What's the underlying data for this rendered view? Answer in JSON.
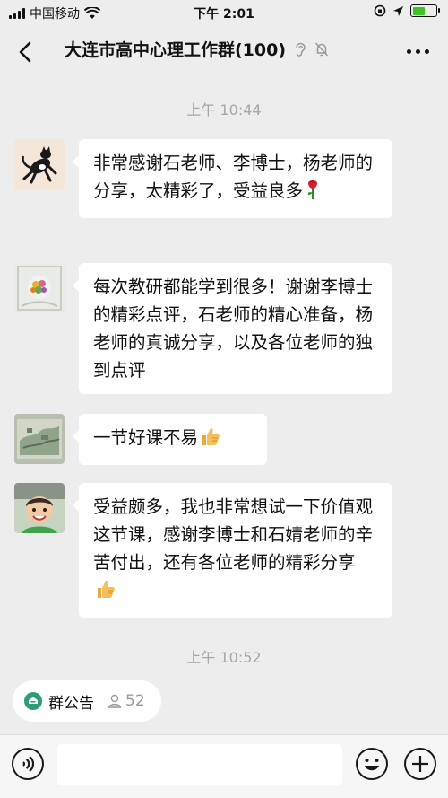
{
  "status_bar": {
    "carrier": "中国移动",
    "time": "下午 2:01"
  },
  "nav": {
    "title": "大连市高中心理工作群(100)",
    "icons": [
      "back-chevron-icon",
      "ear-icon",
      "mute-bell-icon",
      "more-dots-icon"
    ]
  },
  "chat": {
    "timestamps": [
      "上午 10:44",
      "上午 10:52"
    ],
    "messages": [
      {
        "avatar": "cat-avatar",
        "text": "非常感谢石老师、李博士，杨老师的分享，太精彩了，受益良多",
        "emoji": "rose-icon"
      },
      {
        "avatar": "flower-avatar",
        "text": "每次教研都能学到很多！谢谢李博士的精彩点评，石老师的精心准备，杨老师的真诚分享，以及各位老师的独到点评",
        "emoji": ""
      },
      {
        "avatar": "painting-avatar",
        "text": "一节好课不易",
        "emoji": "thumbs-up-icon"
      },
      {
        "avatar": "child-avatar",
        "text": "受益颇多，我也非常想试一下价值观这节课，感谢李博士和石婧老师的辛苦付出，还有各位老师的精彩分享",
        "emoji": "thumbs-up-icon"
      }
    ]
  },
  "announcement": {
    "label": "群公告",
    "count": "52"
  },
  "input_bar": {
    "placeholder": "",
    "icons": [
      "voice-icon",
      "emoji-icon",
      "plus-icon"
    ]
  },
  "colors": {
    "background": "#ededed",
    "bubble": "#ffffff",
    "timestamp": "#a6a6a6",
    "accent_green": "#3cc51f",
    "announce_icon": "#2e9e72"
  }
}
